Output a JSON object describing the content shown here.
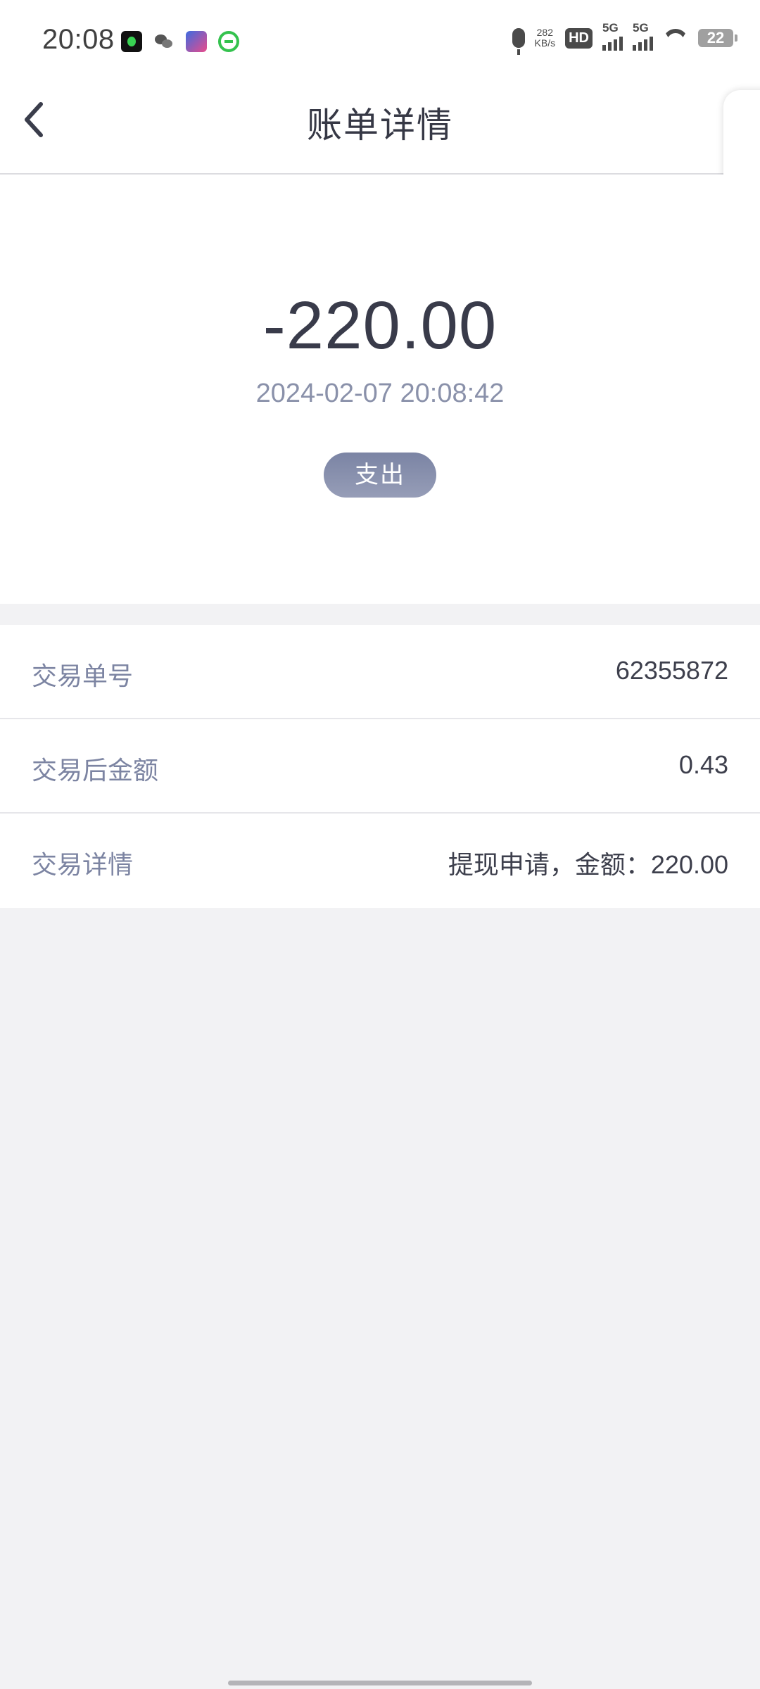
{
  "status_bar": {
    "time": "20:08",
    "net_speed_value": "282",
    "net_speed_unit": "KB/s",
    "hd_label": "HD",
    "signal_1_label": "5G",
    "signal_2_label": "5G",
    "battery_level": "22",
    "icons": [
      "app-icon",
      "wechat-icon",
      "game-app-icon",
      "green-app-icon",
      "mic-icon",
      "hd-icon",
      "signal-icon",
      "wifi-icon",
      "battery-icon"
    ]
  },
  "header": {
    "title": "账单详情",
    "back_icon": "back-chevron-icon"
  },
  "side_tab": {
    "icon": "chevron-left-icon"
  },
  "summary": {
    "amount": "-220.00",
    "datetime": "2024-02-07 20:08:42",
    "type_label": "支出"
  },
  "details": {
    "rows": [
      {
        "label": "交易单号",
        "value": "62355872"
      },
      {
        "label": "交易后金额",
        "value": "0.43"
      },
      {
        "label": "交易详情",
        "value": "提现申请，金额：220.00"
      }
    ]
  },
  "colors": {
    "page_background": "#f2f2f4",
    "badge": "#7b84a4",
    "label_text": "#7c84a2",
    "value_text": "#3d3f4c"
  }
}
